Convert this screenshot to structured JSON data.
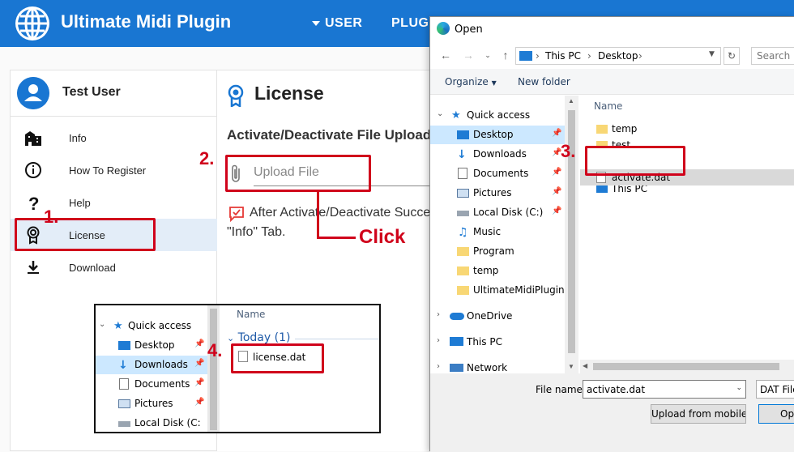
{
  "app": {
    "title": "Ultimate Midi Plugin",
    "nav_user": "USER",
    "nav_plugins": "PLUG"
  },
  "sidebar": {
    "user_name": "Test User",
    "items": [
      {
        "label": "Info",
        "icon": "building-icon"
      },
      {
        "label": "How To Register",
        "icon": "info-circle-icon"
      },
      {
        "label": "Help",
        "icon": "question-icon"
      },
      {
        "label": "License",
        "icon": "award-icon"
      },
      {
        "label": "Download",
        "icon": "download-icon"
      }
    ]
  },
  "main": {
    "title": "License",
    "section_title": "Activate/Deactivate File Upload",
    "upload_placeholder": "Upload File",
    "note_line1": "After Activate/Deactivate Success",
    "note_line2": "\"Info\" Tab."
  },
  "annotations": {
    "step1": "1.",
    "step2": "2.",
    "step3": "3.",
    "step4": "4.",
    "click": "Click",
    "color": "#d0021b"
  },
  "dialog": {
    "title": "Open",
    "breadcrumb": [
      "This PC",
      "Desktop"
    ],
    "search_placeholder": "Search D",
    "organize": "Organize",
    "new_folder": "New folder",
    "nav_items": [
      {
        "label": "Quick access",
        "icon": "star-icon"
      },
      {
        "label": "Desktop",
        "icon": "desktop-icon"
      },
      {
        "label": "Downloads",
        "icon": "download-arrow-icon"
      },
      {
        "label": "Documents",
        "icon": "document-icon"
      },
      {
        "label": "Pictures",
        "icon": "pictures-icon"
      },
      {
        "label": "Local Disk (C:)",
        "icon": "disk-icon"
      },
      {
        "label": "Music",
        "icon": "music-icon"
      },
      {
        "label": "Program",
        "icon": "folder-icon"
      },
      {
        "label": "temp",
        "icon": "folder-icon"
      },
      {
        "label": "UltimateMidiPlugin",
        "icon": "folder-icon"
      },
      {
        "label": "OneDrive",
        "icon": "cloud-icon"
      },
      {
        "label": "This PC",
        "icon": "computer-icon"
      },
      {
        "label": "Network",
        "icon": "network-icon"
      }
    ],
    "column_name": "Name",
    "files": [
      "temp",
      "test",
      "activate.dat",
      "This PC"
    ],
    "file_name_label": "File name:",
    "file_name_value": "activate.dat",
    "file_type": "DAT File",
    "upload_mobile": "Upload from mobile",
    "open_button": "Open"
  },
  "inset": {
    "nav_items": [
      {
        "label": "Quick access"
      },
      {
        "label": "Desktop"
      },
      {
        "label": "Downloads"
      },
      {
        "label": "Documents"
      },
      {
        "label": "Pictures"
      },
      {
        "label": "Local Disk (C:"
      }
    ],
    "column_name": "Name",
    "group": "Today (1)",
    "file": "license.dat"
  }
}
